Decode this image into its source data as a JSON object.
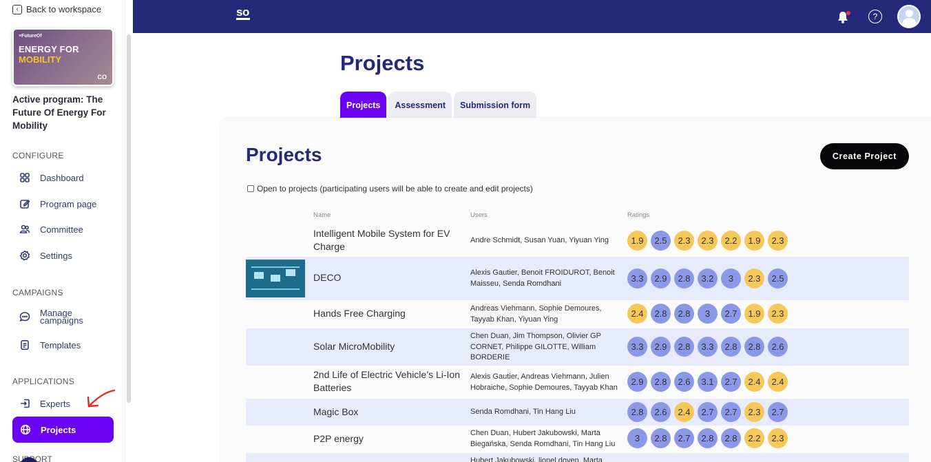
{
  "sidebar": {
    "back_label": "Back to workspace",
    "banner": {
      "small": "≡FutureOf",
      "line1": "ENERGY FOR",
      "line2": "MOBILITY",
      "logo": "CO"
    },
    "active_program": "Active program: The Future Of Energy For Mobility",
    "sections": {
      "configure": "CONFIGURE",
      "campaigns": "CAMPAIGNS",
      "applications": "APPLICATIONS",
      "support": "SUPPORT"
    },
    "items": {
      "dashboard": "Dashboard",
      "program_page": "Program page",
      "committee": "Committee",
      "settings": "Settings",
      "manage_campaigns_1": "Manage",
      "manage_campaigns_2": "campaigns",
      "templates": "Templates",
      "experts": "Experts",
      "projects": "Projects"
    }
  },
  "topbar": {
    "logo": "so",
    "help_glyph": "?"
  },
  "page": {
    "title": "Projects",
    "tabs": [
      {
        "label": "Projects",
        "active": true
      },
      {
        "label": "Assessment",
        "active": false
      },
      {
        "label": "Submission form",
        "active": false
      }
    ]
  },
  "card": {
    "title": "Projects",
    "create_button": "Create Project",
    "open_label": "Open to projects (participating users will be able to create and edit projects)",
    "columns": {
      "name": "Name",
      "users": "Users",
      "ratings": "Ratings"
    }
  },
  "colors": {
    "accent": "#6a00f4",
    "navy": "#242a79",
    "rating_high": "#8b98e8",
    "rating_low": "#f6c85a"
  },
  "projects": [
    {
      "name": "Intelligent Mobile System for EV Charge",
      "users": "Andre Schmidt, Susan Yuan, Yiyuan Ying",
      "ratings": [
        "1.9",
        "2.5",
        "2.3",
        "2.3",
        "2.2",
        "1.9",
        "2.3"
      ]
    },
    {
      "name": "DECO",
      "users": "Alexis Gautier, Benoit FROIDUROT, Benoit Maisseu, Senda Romdhani",
      "ratings": [
        "3.3",
        "2.9",
        "2.8",
        "3.2",
        "3",
        "2.3",
        "2.5"
      ]
    },
    {
      "name": "Hands Free Charging",
      "users": "Andreas Viehmann, Sophie Demoures, Tayyab Khan, Yiyuan Ying",
      "ratings": [
        "2.4",
        "2.8",
        "2.8",
        "3",
        "2.7",
        "1.9",
        "2.3"
      ]
    },
    {
      "name": "Solar MicroMobility",
      "users": "Chen Duan, Jim Thompson, Olivier GP CORNET, Philippe GILOTTE, William BORDERIE",
      "ratings": [
        "3.3",
        "2.9",
        "2.8",
        "3.3",
        "2.8",
        "2.8",
        "2.6"
      ]
    },
    {
      "name": "2nd Life of Electric Vehicle’s Li-Ion Batteries",
      "users": "Alexis Gautier, Andreas Viehmann, Julien Hobraiche, Sophie Demoures, Tayyab Khan",
      "ratings": [
        "2.9",
        "2.8",
        "2.6",
        "3.1",
        "2.7",
        "2.4",
        "2.4"
      ]
    },
    {
      "name": "Magic Box",
      "users": "Senda Romdhani, Tin Hang Liu",
      "ratings": [
        "2.8",
        "2.6",
        "2.4",
        "2.7",
        "2.7",
        "2.3",
        "2.7"
      ]
    },
    {
      "name": "P2P energy",
      "users": "Chen Duan, Hubert Jakubowski, Marta Biegańska, Senda Romdhani, Tin Hang Liu",
      "ratings": [
        "3",
        "2.8",
        "2.7",
        "2.8",
        "2.8",
        "2.2",
        "2.3"
      ]
    },
    {
      "name": "",
      "users": "Hubert Jakubowski, lionel doyen, Marta",
      "ratings": []
    }
  ]
}
